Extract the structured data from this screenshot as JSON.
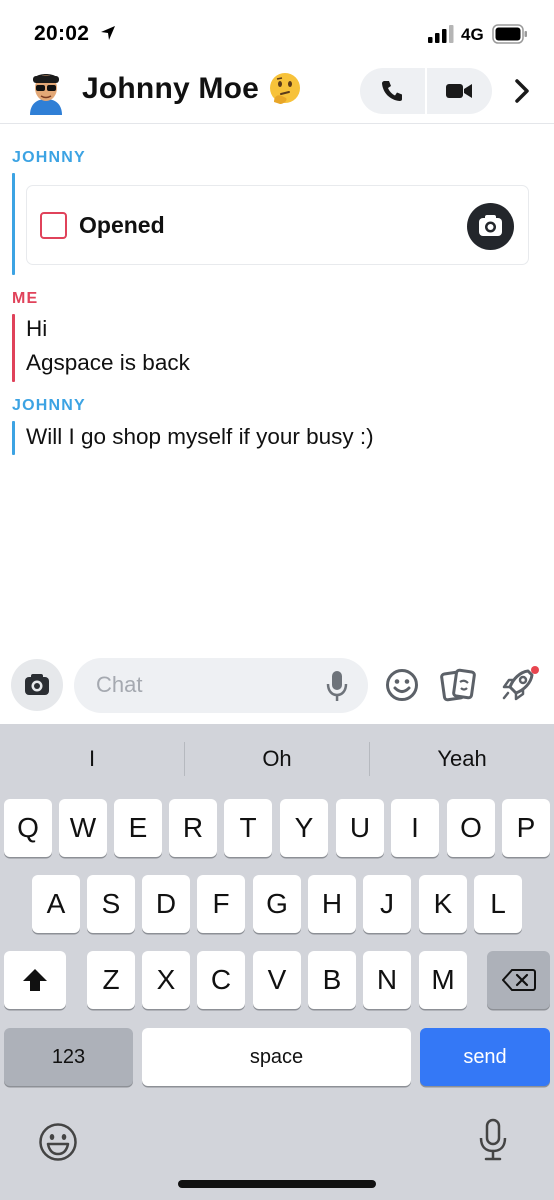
{
  "status_bar": {
    "time": "20:02",
    "network": "4G",
    "icons": [
      "location-arrow-icon",
      "signal-bars-icon",
      "battery-icon"
    ]
  },
  "header": {
    "contact_name": "Johnny Moe",
    "emoji": "thinking-face",
    "icons": [
      "avatar-bitmoji",
      "phone-icon",
      "video-camera-icon",
      "chevron-right-icon"
    ]
  },
  "messages": [
    {
      "sender": "JOHNNY",
      "type": "snap",
      "status": "Opened"
    },
    {
      "sender": "ME",
      "type": "text",
      "lines": [
        "Hi",
        "Agspace is back"
      ]
    },
    {
      "sender": "JOHNNY",
      "type": "text",
      "lines": [
        "Will I go shop myself if your busy :)"
      ]
    }
  ],
  "input_bar": {
    "placeholder": "Chat",
    "icons": [
      "camera-icon",
      "mic-icon",
      "smiley-icon",
      "cards-icon",
      "rocket-icon"
    ]
  },
  "keyboard": {
    "suggestions": [
      "I",
      "Oh",
      "Yeah"
    ],
    "row1": [
      "Q",
      "W",
      "E",
      "R",
      "T",
      "Y",
      "U",
      "I",
      "O",
      "P"
    ],
    "row2": [
      "A",
      "S",
      "D",
      "F",
      "G",
      "H",
      "J",
      "K",
      "L"
    ],
    "row3": [
      "Z",
      "X",
      "C",
      "V",
      "B",
      "N",
      "M"
    ],
    "numbers_key": "123",
    "space_key": "space",
    "send_key": "send"
  },
  "colors": {
    "johnny_accent": "#3ca3e3",
    "me_accent": "#e0425a",
    "send_key": "#3478f6",
    "keyboard_bg": "#d2d4da"
  }
}
